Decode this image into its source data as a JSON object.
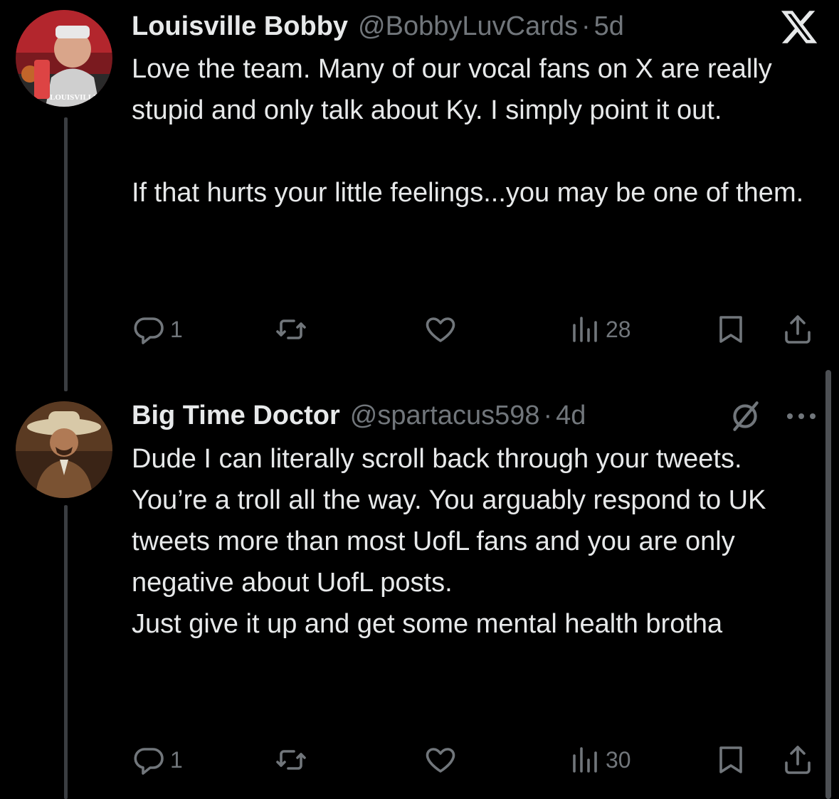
{
  "brand": {
    "logo_icon": "x-logo-icon"
  },
  "tweets": [
    {
      "display_name": "Louisville Bobby",
      "handle": "@BobbyLuvCards",
      "separator": "·",
      "time": "5d",
      "avatar_caption": "LOUISVILLE",
      "paragraphs": [
        "Love the team. Many of our vocal fans on X are really stupid and only talk about Ky. I simply point it out.",
        "If that hurts your little feelings...you may be one of them."
      ],
      "actions": {
        "replies": "1",
        "reposts": "",
        "likes": "",
        "views": "28"
      }
    },
    {
      "display_name": "Big Time Doctor",
      "handle": "@spartacus598",
      "separator": "·",
      "time": "4d",
      "paragraphs": [
        "Dude I can literally scroll back through your tweets. You’re a troll all the way. You arguably respond to UK tweets more than most UofL fans and you are only negative about UofL posts.",
        "Just give it up and get some mental health brotha"
      ],
      "actions": {
        "replies": "1",
        "reposts": "",
        "likes": "",
        "views": "30"
      }
    }
  ],
  "icons": {
    "reply": "reply-icon",
    "repost": "repost-icon",
    "like": "heart-icon",
    "views": "views-icon",
    "bookmark": "bookmark-icon",
    "share": "share-icon",
    "grok": "grok-icon",
    "more": "more-icon"
  },
  "colors": {
    "background": "#000000",
    "text": "#e7e9ea",
    "muted": "#71767b"
  }
}
